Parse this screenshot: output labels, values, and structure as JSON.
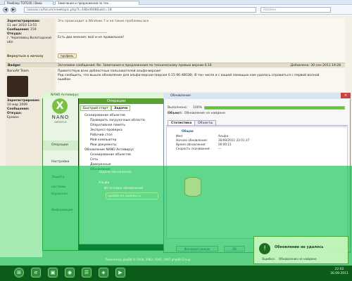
{
  "browser": {
    "tabs": [
      "Рамблер ТОП100 / Вики",
      "Замечания и предложения по тех..."
    ],
    "url": "nanoav.ru/forum/viewtopic.php?t=18bid6086ubit=18",
    "search_placeholder": "Rambler",
    "back": "◀",
    "forward": "▶"
  },
  "forum": {
    "top_msg": "Это происходит в Windows 7 и не такие проблемы все",
    "user1": {
      "registered": "Зарегистрирован:",
      "reg_date": "11 авг 2010 13:55",
      "posts_label": "Сообщения:",
      "posts": "159",
      "from_label": "Откуда:",
      "from": "г. Череповец Вологодской обл."
    },
    "signature": "Есть два мнения: моё и не правильное!",
    "back_to_top": "Вернуться к началу",
    "profile": "профиль",
    "header_author": "Badger",
    "header_title": "Заголовок сообщения: Re: Замечания и предложения по техническому превью версии 0.16",
    "header_added": "Добавлено: 30 сен 2011 19:28",
    "user2": {
      "name": "NanoAV Team",
      "registered": "Зарегистрирован:",
      "reg_date": "10 мар 2009",
      "posts_label": "Сообщения:",
      "from_label": "Откуда:",
      "from": "Ереван"
    },
    "post_line1": "Приветствую всех доблестных пользователей альфа-версии!",
    "post_line2": "Рад сообщить, что вышло обновление для альфа-версии (версия 0.15.90.48038). В тон числе и с вашей помощью нам удалось справиться с первой волной",
    "post_line3": "ошибок.",
    "footer": "Powered by phpBB © 2000, 2002, 2005, 2007 phpBB Group"
  },
  "nano": {
    "window_title": "NANO Антивирус",
    "logo_glyph": "X",
    "name": "NANO",
    "sub": "antivirus",
    "side_items": [
      "Операции",
      "Настройки",
      "Защита системы",
      "Карантин",
      "Информация"
    ],
    "panel_title": "Операции",
    "tabs": [
      "Быстрый старт",
      "Задачи"
    ],
    "tree": [
      "Сканирование объектов",
      "Проверить загрузочные области",
      "Оперативная память",
      "Экспресс-проверка",
      "Рабочий стол",
      "Мой компьютер",
      "Мои документы",
      "Обновление NANO Антивирус",
      "Сканирование объектов",
      "Сеть",
      "Доверенные",
      "Обновление"
    ],
    "overlay_tree": [
      "Задачи обновления",
      "Альфа",
      "Источники обновлений"
    ],
    "overlay_url": "update-nn.nanoav.ru"
  },
  "update": {
    "title": "Обновление",
    "done_label": "Выполнено:",
    "done_value": "100%",
    "progress_fraction": 1.0,
    "object_label": "Объект:",
    "object_value": "Обновление не найдено",
    "tabs": [
      "Статистика",
      "Объекты"
    ],
    "section": "Общая",
    "rows": [
      {
        "k": "Имя:",
        "v": "Альфа"
      },
      {
        "k": "Начало обновления:",
        "v": "30/09/2011 22:01:37"
      },
      {
        "k": "Время обновления:",
        "v": "00:00:11"
      },
      {
        "k": "Скорость скачивания:",
        "v": "—"
      }
    ],
    "bg_button": "Фоновый режим",
    "ok_button": "OK"
  },
  "notification": {
    "title": "Обновление не удалось",
    "error_label": "Ошибка:",
    "error_text": "Обновление не найдено"
  },
  "taskbar": {
    "icons": [
      "⊞",
      "e",
      "▣",
      "◉",
      "☰",
      "◈",
      "▶"
    ],
    "time": "22:02",
    "date": "30.09.2011"
  }
}
